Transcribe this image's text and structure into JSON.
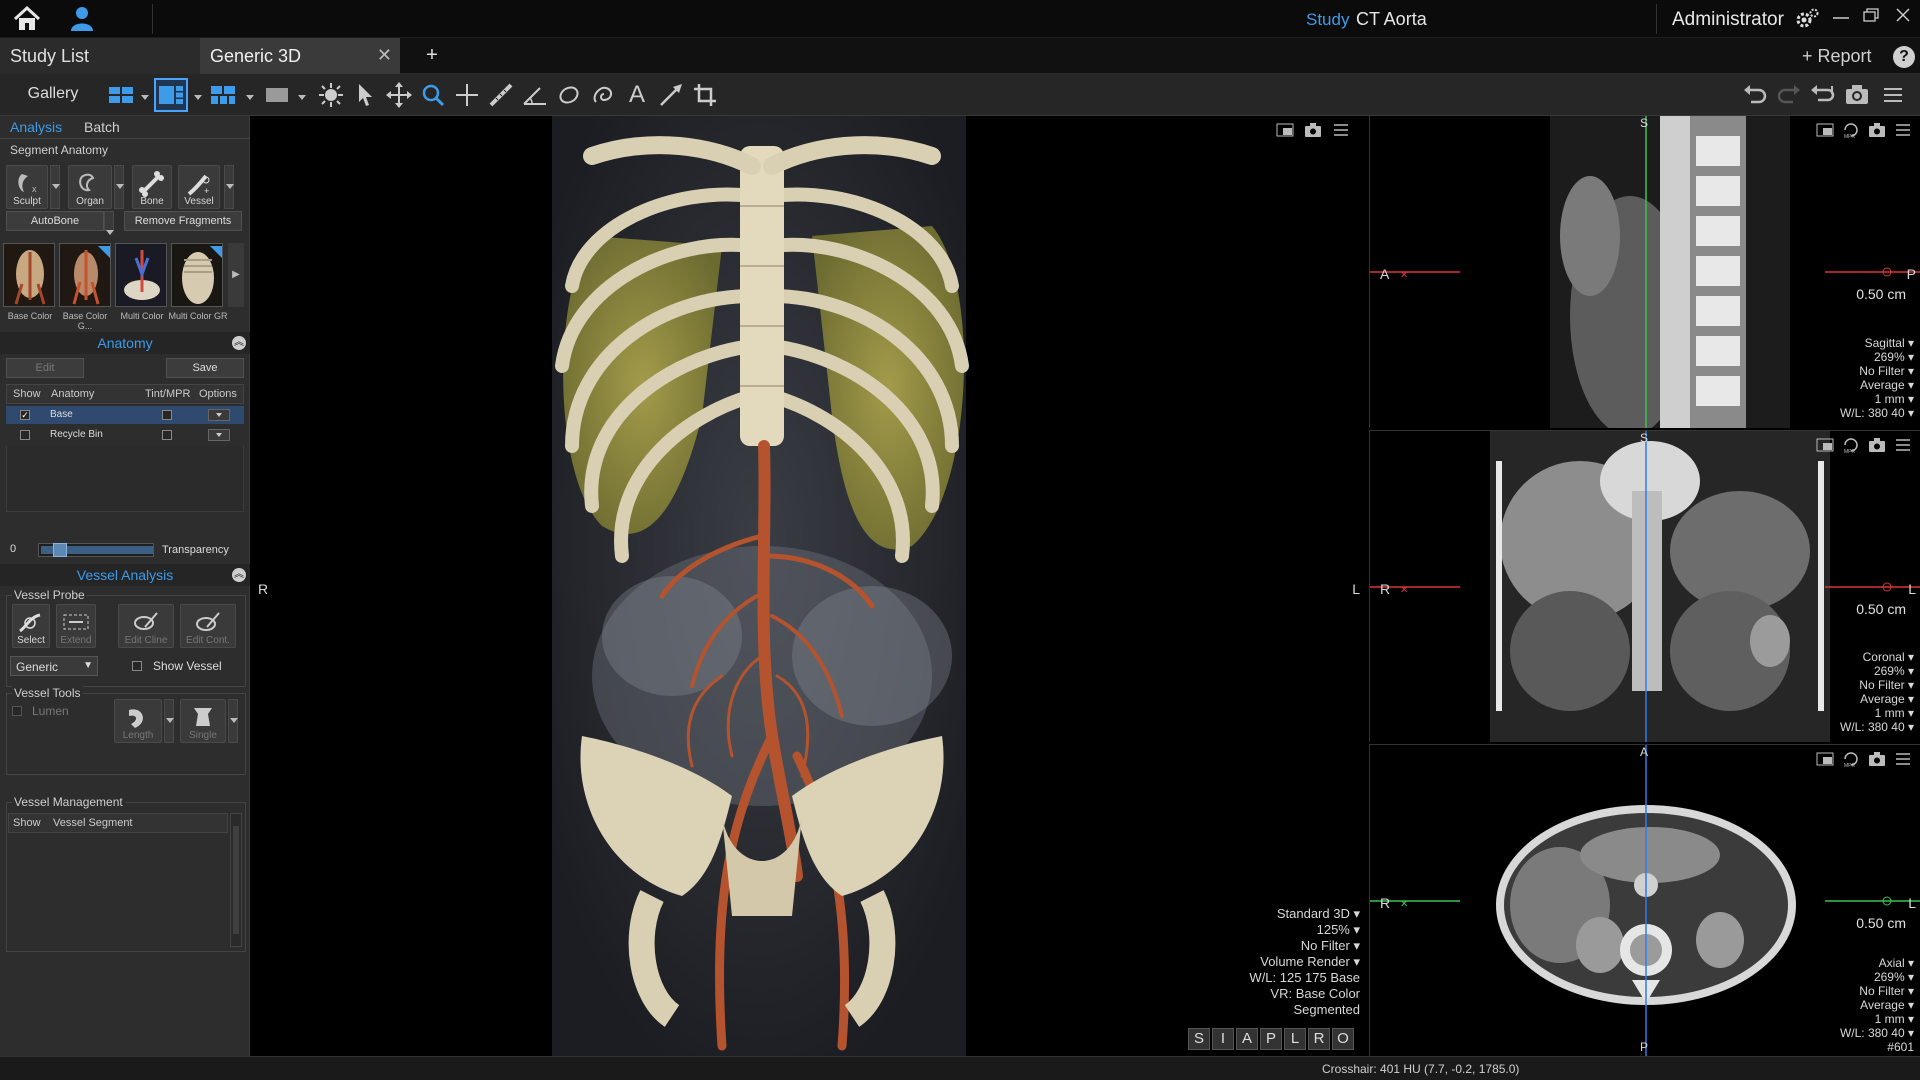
{
  "titlebar": {
    "study_label": "Study",
    "study_name": "CT Aorta",
    "user_name": "Administrator"
  },
  "tabs": {
    "study_list": "Study List",
    "generic_3d": "Generic 3D",
    "close": "✕",
    "add": "+",
    "report": "+ Report",
    "help": "?"
  },
  "toolbar": {
    "gallery": "Gallery",
    "text_tool": "A"
  },
  "leftpanel": {
    "subtabs": {
      "analysis": "Analysis",
      "batch": "Batch"
    },
    "segment_anatomy": "Segment Anatomy",
    "tools": {
      "sculpt": "Sculpt",
      "organ": "Organ",
      "bone": "Bone",
      "vessel": "Vessel"
    },
    "autobone": "AutoBone",
    "remove_fragments": "Remove Fragments",
    "presets": [
      "Base Color",
      "Base Color G...",
      "Multi Color",
      "Multi Color GR"
    ],
    "anatomy": {
      "header": "Anatomy",
      "edit": "Edit",
      "save": "Save",
      "columns": [
        "Show",
        "Anatomy",
        "Tint/MPR",
        "Options"
      ],
      "rows": [
        {
          "name": "Base",
          "shown": true
        },
        {
          "name": "Recycle Bin",
          "shown": false
        }
      ],
      "transparency_value": "0",
      "transparency_label": "Transparency"
    },
    "vessel_analysis": {
      "header": "Vessel Analysis",
      "vessel_probe": "Vessel Probe",
      "probe_tools": [
        "Select",
        "Extend",
        "Edit Cline",
        "Edit Cont."
      ],
      "type_select": "Generic",
      "show_vessel": "Show Vessel",
      "vessel_tools": "Vessel Tools",
      "lumen": "Lumen",
      "length": "Length",
      "single": "Single",
      "vessel_management": "Vessel Management",
      "mgmt_columns": [
        "Show",
        "Vessel Segment"
      ]
    }
  },
  "viewport3d": {
    "left_label": "R",
    "right_label": "L",
    "info": [
      "Standard 3D ▾",
      "125% ▾",
      "No Filter ▾",
      "Volume Render ▾",
      "W/L: 125 175 Base",
      "VR: Base Color",
      "Segmented"
    ],
    "view_buttons": [
      "S",
      "I",
      "A",
      "P",
      "L",
      "R",
      "O"
    ]
  },
  "sagittal": {
    "top_label": "S",
    "left_label": "A",
    "right_label": "P",
    "thickness": "0.50 cm",
    "info": [
      "Sagittal ▾",
      "269% ▾",
      "No Filter ▾",
      "Average ▾",
      "1 mm ▾",
      "W/L: 380 40 ▾"
    ]
  },
  "coronal": {
    "top_label": "S",
    "left_label": "R",
    "right_label": "L",
    "thickness": "0.50 cm",
    "info": [
      "Coronal ▾",
      "269% ▾",
      "No Filter ▾",
      "Average ▾",
      "1 mm ▾",
      "W/L: 380 40 ▾"
    ]
  },
  "axial": {
    "top_label": "A",
    "bottom_label": "P",
    "left_label": "R",
    "right_label": "L",
    "thickness": "0.50 cm",
    "info": [
      "Axial ▾",
      "269% ▾",
      "No Filter ▾",
      "Average ▾",
      "1 mm ▾",
      "W/L: 380 40 ▾",
      "#601"
    ]
  },
  "statusbar": {
    "crosshair": "Crosshair: 401 HU (7.7, -0.2, 1785.0)"
  },
  "colors": {
    "accent": "#3d9bea",
    "panel": "#2d2d2d",
    "bone": "#d9cfb2",
    "vessel": "#b5532f",
    "lung": "#8f8a3e"
  }
}
